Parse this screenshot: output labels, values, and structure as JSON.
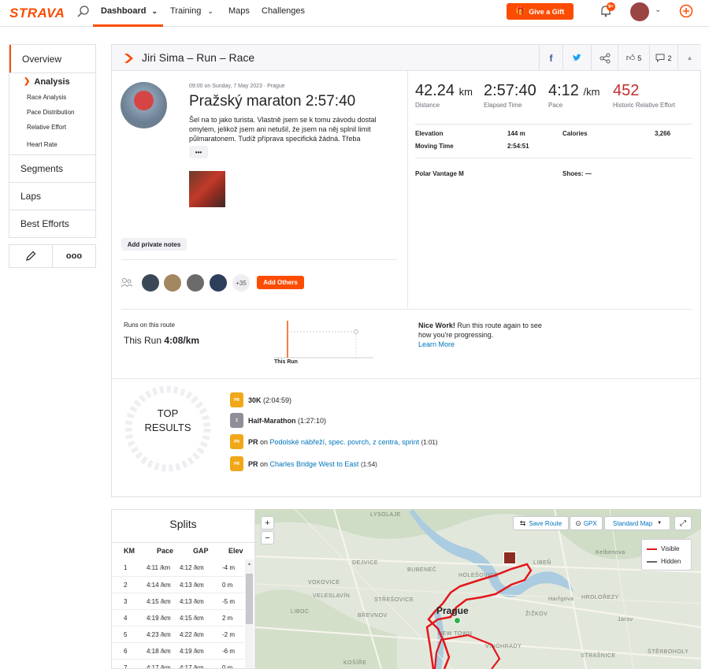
{
  "nav": {
    "logo": "STRAVA",
    "dashboard": "Dashboard",
    "training": "Training",
    "maps": "Maps",
    "challenges": "Challenges",
    "gift": "Give a Gift",
    "notif_badge": "9+"
  },
  "sidebar": {
    "overview": "Overview",
    "analysis": "Analysis",
    "sub": [
      "Race Analysis",
      "Pace Distribution",
      "Relative Effort",
      "Heart Rate"
    ],
    "segments": "Segments",
    "laps": "Laps",
    "best_efforts": "Best Efforts",
    "more": "ooo"
  },
  "header": {
    "title": "Jiri Sima – Run – Race",
    "kudos": "5",
    "comments": "2"
  },
  "activity": {
    "meta": "09:00 on Sunday, 7 May 2023 · Prague",
    "title": "Pražský maraton 2:57:40",
    "desc": "Šel na to jako turista. Vlastně jsem se k tomu závodu dostal omylem, jelikož jsem ani netušil, že jsem na něj splnil limit půlmaratonem. Tudíž příprava specifická žádná. Třeba",
    "more": "•••",
    "private_notes": "Add private notes",
    "others_count": "+35",
    "add_others": "Add Others"
  },
  "stats": {
    "distance_val": "42.24",
    "distance_unit": "km",
    "distance_lbl": "Distance",
    "elapsed_val": "2:57:40",
    "elapsed_lbl": "Elapsed Time",
    "pace_val": "4:12",
    "pace_unit": "/km",
    "pace_lbl": "Pace",
    "effort_val": "452",
    "effort_lbl": "Historic Relative Effort",
    "elevation_lbl": "Elevation",
    "elevation_val": "144 m",
    "calories_lbl": "Calories",
    "calories_val": "3,266",
    "moving_lbl": "Moving Time",
    "moving_val": "2:54:51",
    "device": "Polar Vantage M",
    "shoes": "Shoes: —"
  },
  "route": {
    "label": "Runs on this route",
    "this_run_prefix": "This Run",
    "this_run_val": "4:08/km",
    "chart_lbl": "This Run",
    "nice_bold": "Nice Work!",
    "nice_rest": " Run this route again to see how you're progressing.",
    "learn": "Learn More"
  },
  "top_results": {
    "heading1": "TOP",
    "heading2": "RESULTS",
    "items": [
      {
        "medal": "PR",
        "text": "30K",
        "time": "(2:04:59)"
      },
      {
        "medal": "2",
        "text": "Half-Marathon",
        "time": "(1:27:10)"
      },
      {
        "medal": "PR",
        "prefix": "PR",
        "on": " on ",
        "link": "Podolské nábřeží, spec. povrch, z centra, sprint",
        "time": "(1:01)"
      },
      {
        "medal": "PR",
        "prefix": "PR",
        "on": " on ",
        "link": "Charles Bridge West to East",
        "time": "(1:54)"
      }
    ],
    "colors": {
      "pr": "#f0a818",
      "silver": "#8f8f99"
    }
  },
  "splits": {
    "title": "Splits",
    "cols": [
      "KM",
      "Pace",
      "GAP",
      "Elev"
    ],
    "rows": [
      [
        "1",
        "4:11 /km",
        "4:12 /km",
        "-4 m"
      ],
      [
        "2",
        "4:14 /km",
        "4:13 /km",
        "0 m"
      ],
      [
        "3",
        "4:15 /km",
        "4:13 /km",
        "-5 m"
      ],
      [
        "4",
        "4:19 /km",
        "4:15 /km",
        "2 m"
      ],
      [
        "5",
        "4:23 /km",
        "4:22 /km",
        "-2 m"
      ],
      [
        "6",
        "4:18 /km",
        "4:19 /km",
        "-6 m"
      ],
      [
        "7",
        "4:17 /km",
        "4:17 /km",
        "0 m"
      ]
    ]
  },
  "map": {
    "save_route": "Save Route",
    "gpx": "GPX",
    "style": "Standard Map",
    "visible": "Visible",
    "hidden": "Hidden",
    "city": "Prague",
    "labels": [
      "LYSOLAJE",
      "DEJVICE",
      "BUBENEČ",
      "HOLEŠOVICE",
      "LIBEŇ",
      "VOKOVICE",
      "VELESLAVÍN",
      "STŘEŠOVICE",
      "LIBOC",
      "BŘEVNOV",
      "NEW TOWN",
      "ŽIŽKOV",
      "HRDLOŘEZY",
      "VINOHRADY",
      "STRAŠNICE",
      "KOŠÍŘE",
      "Kelbenova",
      "Harfgova",
      "Jarov",
      "ŠTĚRBOHOLY"
    ]
  },
  "colors": {
    "accent": "#fc4c02",
    "effort": "#c12d2d",
    "route": "#e3161b",
    "link": "#0074ba"
  }
}
